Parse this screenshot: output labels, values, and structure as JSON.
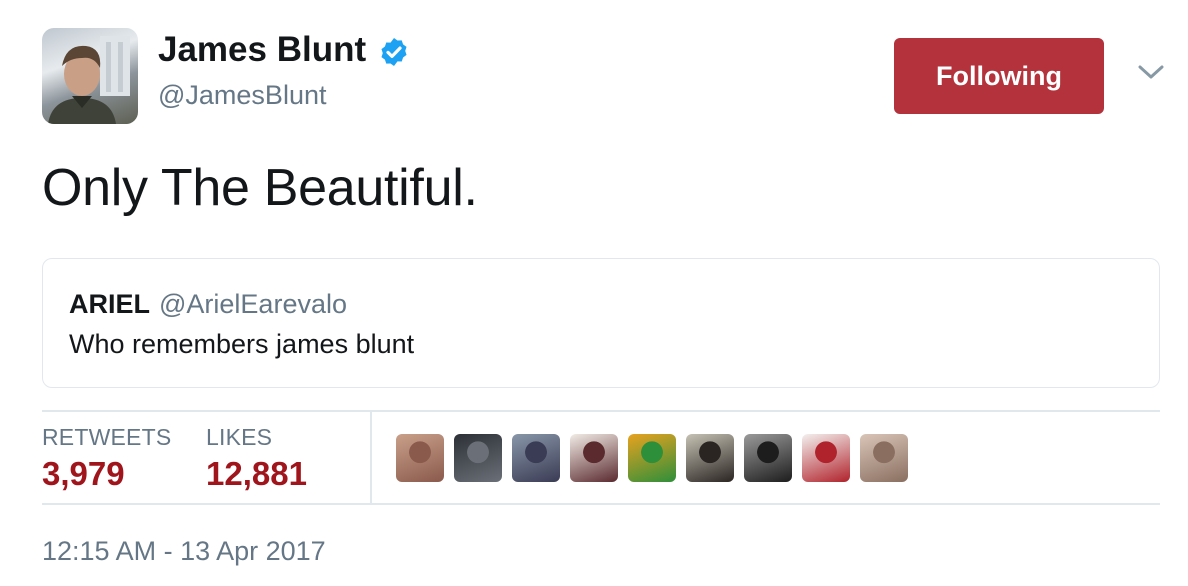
{
  "author": {
    "display_name": "James Blunt",
    "handle": "@JamesBlunt",
    "verified_icon": "verified-badge-icon"
  },
  "follow_button": {
    "label": "Following",
    "color": "#b3323b"
  },
  "more_menu": {
    "icon": "chevron-down-icon"
  },
  "tweet": {
    "text": "Only The Beautiful."
  },
  "quoted_tweet": {
    "name": "ARIEL",
    "handle": "@ArielEarevalo",
    "text": "Who remembers james blunt"
  },
  "stats": {
    "retweets_label": "RETWEETS",
    "retweets_value": "3,979",
    "likes_label": "LIKES",
    "likes_value": "12,881",
    "value_color": "#a0141c"
  },
  "likers": [
    {
      "colors": [
        "#c9a08a",
        "#8a5a4c"
      ]
    },
    {
      "colors": [
        "#2c3036",
        "#6b7078"
      ]
    },
    {
      "colors": [
        "#8896a8",
        "#3a3b54"
      ]
    },
    {
      "colors": [
        "#f2ece6",
        "#5a2a2f"
      ]
    },
    {
      "colors": [
        "#e8a21f",
        "#2e8f3a"
      ]
    },
    {
      "colors": [
        "#c6c2b4",
        "#2a2522"
      ]
    },
    {
      "colors": [
        "#9a9a9a",
        "#1d1d1d"
      ]
    },
    {
      "colors": [
        "#f3f1ef",
        "#b0232c"
      ]
    },
    {
      "colors": [
        "#d9c5b8",
        "#8a6f60"
      ]
    }
  ],
  "timestamp": "12:15 AM - 13 Apr 2017"
}
